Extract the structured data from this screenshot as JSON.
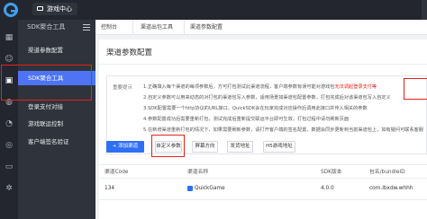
{
  "topbar": {
    "app_label": "游戏中心"
  },
  "sidebar": {
    "title": "SDK聚合工具",
    "items": [
      {
        "label": "渠道参数配置"
      },
      {
        "label": "SDK聚合工具"
      },
      {
        "label": "登录支付对接"
      },
      {
        "label": "游戏联运控制"
      },
      {
        "label": "客户端签名验证"
      }
    ]
  },
  "breadcrumb": {
    "items": [
      "控制台",
      "渠道出包工具",
      "渠道参数配置"
    ]
  },
  "panel": {
    "title": "渠道参数配置",
    "notice_label": "重要提示",
    "notice_lines": [
      [
        "1.正确填入每个渠道的每项参数后，方可打包测试此渠道流程，客户端参数有误可能对游戏包",
        "无法调起登录支付等"
      ],
      [
        "2.自定义参数可以用来动态的对打包的渠道包写入参数，适用场景如渠道包配置参数，打包完成后对该渠道包写入自定义"
      ],
      [
        "3.SDK配置需要一个http协议的URL接口，QuickSDK会在玩家完成对应操作后调用此接口并传入相关的参数"
      ],
      [
        "4.参数配置成功后需要重新打包，测试完成后重新提交联运平台即可生效，打包过程中请勿刷新页面"
      ],
      [
        "5.在新增渠道重新打包的情况下，如果需要刷新参数，请打开客户端的签名配置，数据会同步更新到当前渠道包上，如有疑问可联系客服"
      ]
    ]
  },
  "buttons": {
    "add_channel": "+ 添加渠道",
    "custom_params": "自定义参数",
    "screen_orientation": "屏幕方向",
    "callback_url": "发货地址",
    "h5_url": "H5游戏地址"
  },
  "table": {
    "headers": {
      "code": "渠道Code",
      "name": "渠道名称",
      "sdk_version": "SDK版本",
      "package": "包名/bundleID"
    },
    "rows": [
      {
        "code": "134",
        "name": "QuickGame",
        "sdk_version": "4.0.0",
        "package": "com.lbxdw.whhh"
      }
    ]
  }
}
